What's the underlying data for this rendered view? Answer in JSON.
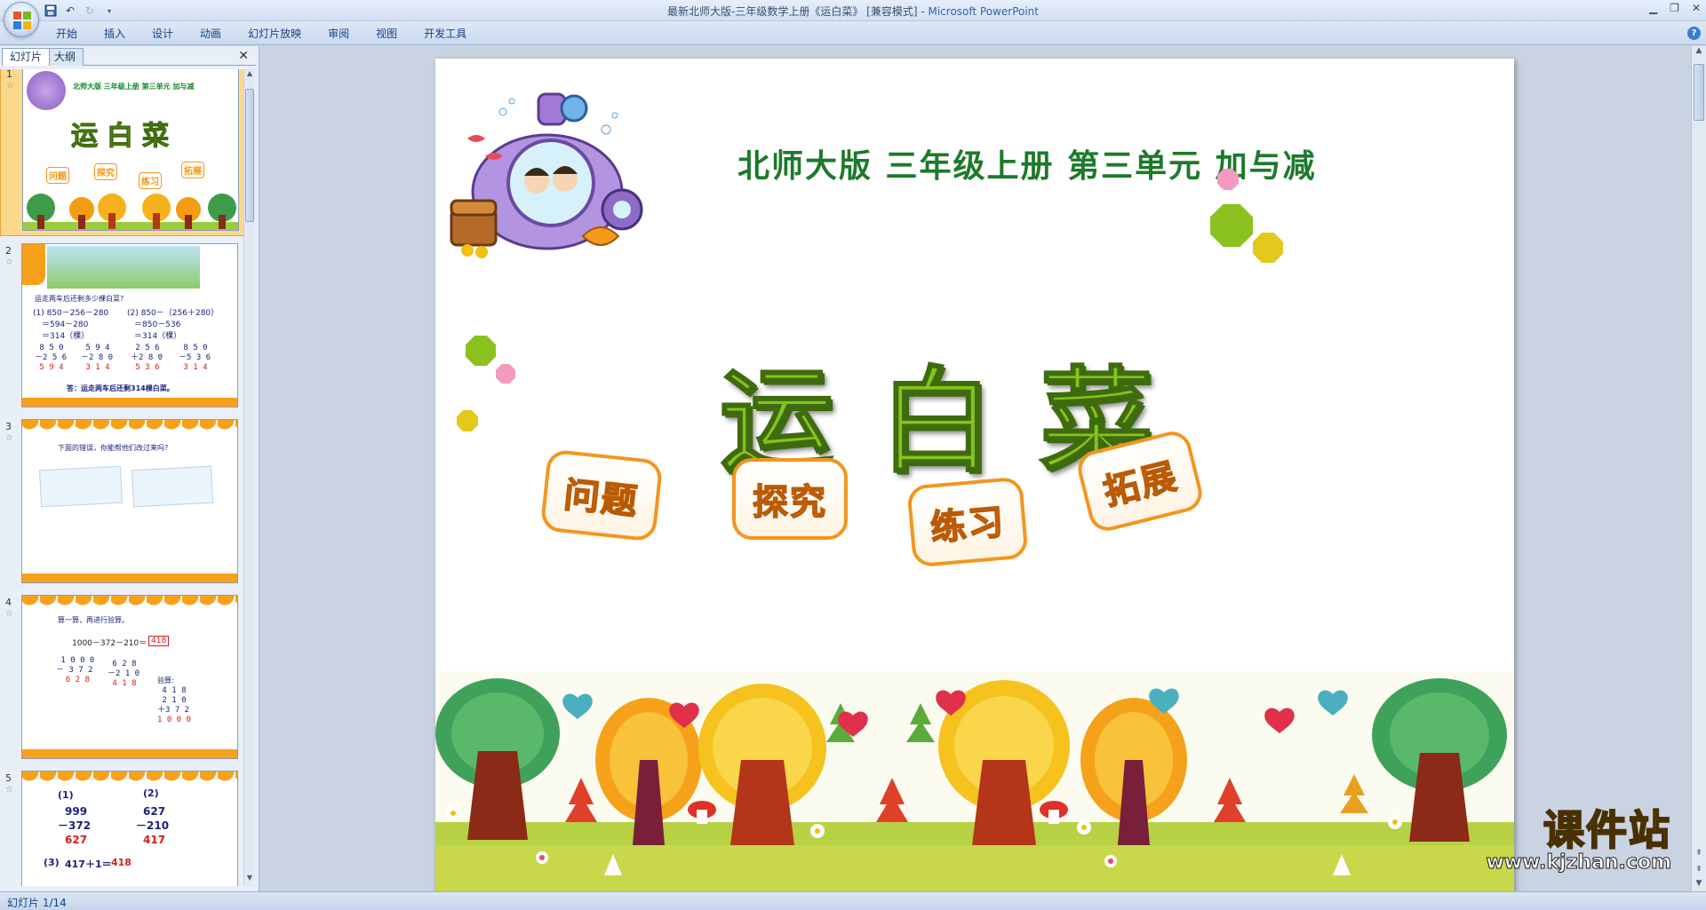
{
  "window": {
    "title": "最新北师大版-三年级数学上册《运白菜》 [兼容模式] - ",
    "app": "Microsoft PowerPoint"
  },
  "ribbon": {
    "tabs": [
      "开始",
      "插入",
      "设计",
      "动画",
      "幻灯片放映",
      "审阅",
      "视图",
      "开发工具"
    ]
  },
  "left_pane": {
    "tabs": [
      "幻灯片",
      "大纲"
    ],
    "close_label": "✕",
    "thumbnails": [
      {
        "number": "1",
        "title": "北师大版  三年级上册  第三单元  加与减",
        "big": "运白菜",
        "tiles": [
          "问题",
          "探究",
          "练习",
          "拓展"
        ]
      },
      {
        "number": "2",
        "caption": "运走两车后还剩多少棵白菜?",
        "line1a": "(1) 850－256－280",
        "line1b": "(2) 850－（256＋280）",
        "line2a": "＝594－280",
        "line2b": "＝850－536",
        "line3a": "＝314（棵）",
        "line3b": "＝314（棵）",
        "answer": "答：运走两车后还剩314棵白菜。"
      },
      {
        "number": "3",
        "caption": "下面的错误，你能帮他们改过来吗?"
      },
      {
        "number": "4",
        "caption": "算一算，再进行验算。",
        "expr": "1000－372－210＝",
        "result": "418",
        "check": "验算:"
      },
      {
        "number": "5",
        "label1": "(1)",
        "label2": "(2)",
        "label3": "(3)",
        "line3": "417＋1＝",
        "line3_res": "418",
        "a1": "999",
        "a2": "－372",
        "a3": "627",
        "b1": "627",
        "b2": "－210",
        "b3": "417"
      }
    ]
  },
  "slide": {
    "header": "北师大版  三年级上册  第三单元  加与减",
    "title": "运白菜",
    "tiles": [
      "问题",
      "探究",
      "练习",
      "拓展"
    ],
    "colors": {
      "title_green": "#1c7a2a",
      "big_green": "#86c41a",
      "tile_orange": "#f3961e"
    }
  },
  "watermark": {
    "text": "课件站",
    "url": "www.kjzhan.com"
  },
  "status": {
    "slide_info": "幻灯片 1/14"
  }
}
